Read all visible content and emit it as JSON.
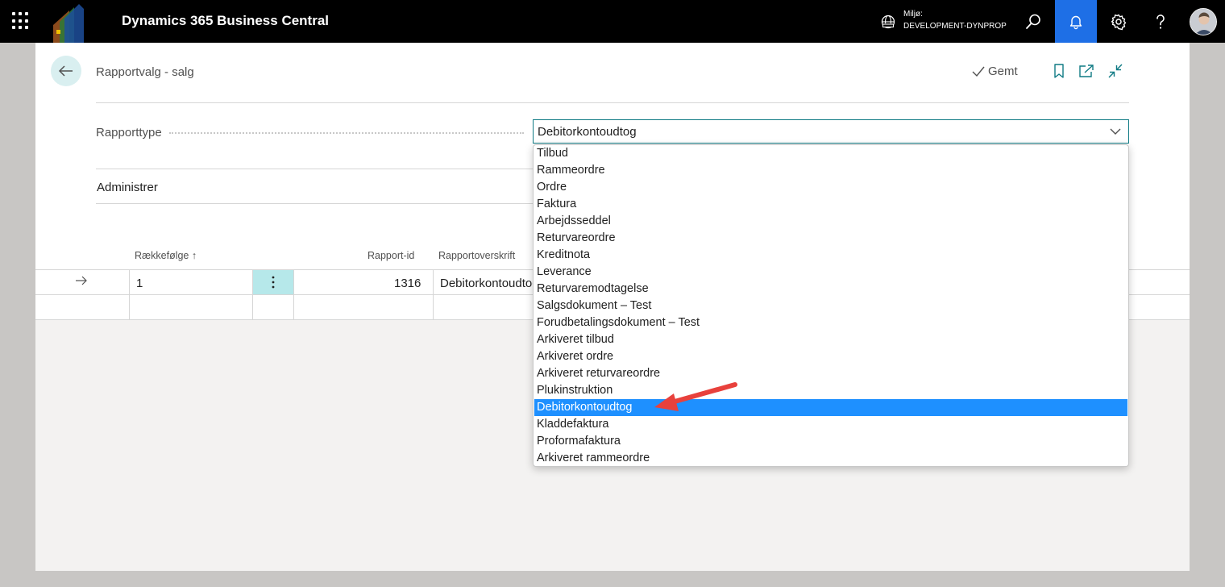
{
  "app": {
    "title": "Dynamics 365 Business Central",
    "environment_label": "Miljø:",
    "environment_value": "DEVELOPMENT-DYNPROP"
  },
  "topbar_icons": [
    "waffle-icon",
    "globe-icon",
    "search-icon",
    "bell-icon",
    "gear-icon",
    "help-icon"
  ],
  "colors": {
    "accent": "#1e6fe6",
    "teal": "#0f7a84",
    "selected_option": "#1e90ff",
    "arrow": "#e8413c"
  },
  "page": {
    "title": "Rapportvalg - salg",
    "saved_label": "Gemt"
  },
  "field": {
    "label": "Rapporttype",
    "value": "Debitorkontoudtog"
  },
  "section": {
    "title": "Administrer"
  },
  "table": {
    "headers": {
      "sequence": "Rækkefølge",
      "report_id": "Rapport-id",
      "report_caption": "Rapportoverskrift"
    },
    "rows": [
      {
        "sequence": "1",
        "report_id": "1316",
        "report_caption": "Debitorkontoudtog"
      }
    ]
  },
  "dropdown": {
    "options": [
      "Tilbud",
      "Rammeordre",
      "Ordre",
      "Faktura",
      "Arbejdsseddel",
      "Returvareordre",
      "Kreditnota",
      "Leverance",
      "Returvaremodtagelse",
      "Salgsdokument – Test",
      "Forudbetalingsdokument – Test",
      "Arkiveret tilbud",
      "Arkiveret ordre",
      "Arkiveret returvareordre",
      "Plukinstruktion",
      "Debitorkontoudtog",
      "Kladdefaktura",
      "Proformafaktura",
      "Arkiveret rammeordre"
    ],
    "selected_index": 15
  }
}
